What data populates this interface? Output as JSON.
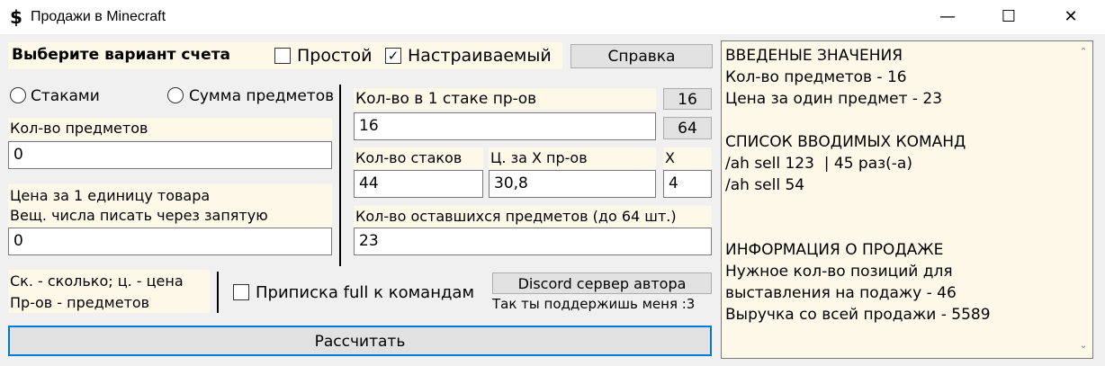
{
  "window": {
    "title": "Продажи в Minecraft",
    "icon_glyph": "$",
    "minimize_glyph": "—",
    "maximize_glyph": "☐",
    "close_glyph": "✕"
  },
  "account": {
    "label": "Выберите вариант счета",
    "simple_label": "Простой",
    "simple_checked": false,
    "custom_label": "Настраиваемый",
    "custom_checked": true,
    "help_button": "Справка"
  },
  "mode": {
    "stacks_label": "Стаками",
    "sum_label": "Сумма предметов"
  },
  "left": {
    "items_count_label": "Кол-во предметов",
    "items_count_value": "0",
    "price_label_line1": "Цена за 1 единицу товара",
    "price_label_line2": "Вещ. числа писать через запятую",
    "price_value": "0"
  },
  "middle": {
    "stack_size_label": "Кол-во в 1 стаке пр-ов",
    "stack_size_value": "16",
    "stack_btn_16": "16",
    "stack_btn_64": "64",
    "stacks_count_label": "Кол-во стаков",
    "stacks_count_value": "44",
    "price_x_label": "Ц. за X пр-ов",
    "price_x_value": "30,8",
    "x_label": "X",
    "x_value": "4",
    "remaining_label": "Кол-во оставшихся предметов (до 64 шт.)",
    "remaining_value": "23"
  },
  "legend": {
    "line1": "Ск. - сколько; ц. - цена",
    "line2": "Пр-ов - предметов"
  },
  "full_suffix": {
    "label": "Приписка full к командам",
    "checked": false
  },
  "discord": {
    "button": "Discord сервер автора",
    "caption": "Так ты поддержишь меня :3"
  },
  "calculate_button": "Рассчитать",
  "info": {
    "lines": [
      "ВВЕДЕНЫЕ ЗНАЧЕНИЯ",
      "Кол-во предметов - 16",
      "Цена за один предмет - 23",
      "",
      "СПИСОК ВВОДИМЫХ КОМАНД",
      "/ah sell 123  | 45 раз(-а)",
      "/ah sell 54",
      "",
      "",
      "ИНФОРМАЦИЯ О ПРОДАЖЕ",
      "Нужное кол-во позиций для",
      "выставления на подажу - 46",
      "Выручка со всей продажи - 5589"
    ],
    "scroll_up_glyph": "⌃",
    "scroll_down_glyph": "⌄"
  }
}
